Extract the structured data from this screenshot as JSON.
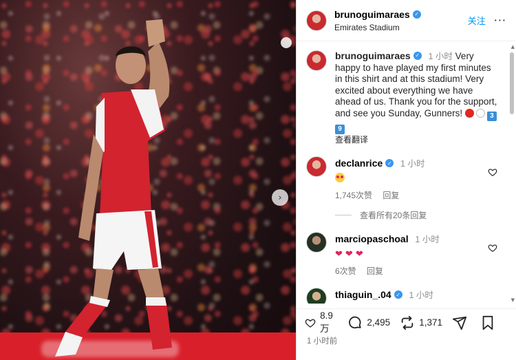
{
  "post": {
    "author": "brunoguimaraes",
    "location": "Emirates Stadium",
    "follow_label": "关注",
    "more_label": "···",
    "caption_time": "1 小时",
    "caption_text": "Very happy to have played my first minutes in this shirt and at this stadium! Very excited about everything we have ahead of us. Thank you for the support, and see you Sunday, Gunners!",
    "caption_keycaps": [
      "3",
      "9"
    ],
    "see_translation": "查看翻译",
    "posted_time": "1 小时前"
  },
  "comments": [
    {
      "user": "declanrice",
      "verified": true,
      "time": "1 小时",
      "text_type": "face",
      "likes": "1,745次赞",
      "reply_label": "回复"
    },
    {
      "user": "marciopaschoal",
      "verified": false,
      "time": "1 小时",
      "text_type": "hearts",
      "likes": "6次赞",
      "reply_label": "回复"
    },
    {
      "user": "thiaguin_.04",
      "verified": true,
      "time": "1 小时",
      "text_type": "face-fire"
    }
  ],
  "view_replies": "查看所有20条回复",
  "actions": {
    "likes": "8.9 万",
    "comments": "2,495",
    "reposts": "1,371"
  },
  "icons": {
    "heart": "heart-icon",
    "comment": "comment-icon",
    "repost": "repost-icon",
    "share": "send-icon",
    "bookmark": "bookmark-icon",
    "next": "chevron-right-icon"
  },
  "colors": {
    "accent": "#0095f6",
    "verified": "#3897f0",
    "arsenal_red": "#d9202a"
  }
}
